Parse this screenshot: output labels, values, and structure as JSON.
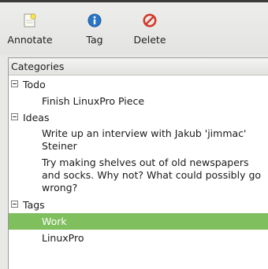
{
  "toolbar": {
    "annotate_label": "Annotate",
    "tag_label": "Tag",
    "delete_label": "Delete"
  },
  "tree": {
    "header": "Categories",
    "groups": [
      {
        "label": "Todo",
        "items": [
          "Finish LinuxPro Piece"
        ]
      },
      {
        "label": "Ideas",
        "items": [
          [
            "Write up an interview with Jakub 'jimmac'",
            "Steiner"
          ],
          [
            "Try making shelves out of old newspapers",
            "and socks. Why not? What could possibly go",
            "wrong?"
          ]
        ]
      },
      {
        "label": "Tags",
        "items": [
          "Work",
          "LinuxPro"
        ]
      }
    ]
  },
  "colors": {
    "selection": "#7fbf5e",
    "info_icon": "#2a76c6",
    "delete_icon": "#d23a2a"
  },
  "icons": {
    "annotate": "note-icon",
    "tag": "info-icon",
    "delete": "no-entry-icon"
  }
}
